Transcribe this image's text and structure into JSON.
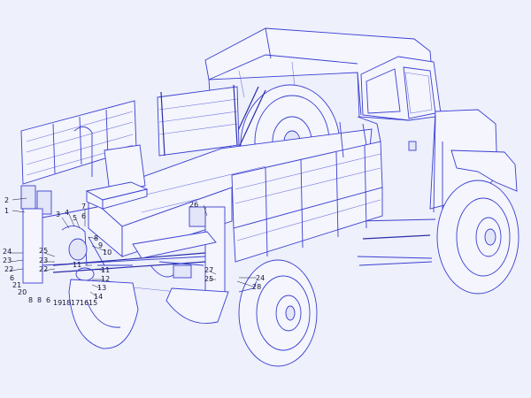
{
  "figure": {
    "background": "#eef0fb",
    "line_color": "#3a3fd0",
    "callouts": [
      {
        "id": "c2",
        "label": "2"
      },
      {
        "id": "c1",
        "label": "1"
      },
      {
        "id": "c3",
        "label": "3"
      },
      {
        "id": "c4",
        "label": "4"
      },
      {
        "id": "c5",
        "label": "5"
      },
      {
        "id": "c6a",
        "label": "6"
      },
      {
        "id": "c7",
        "label": "7"
      },
      {
        "id": "c8a",
        "label": "8"
      },
      {
        "id": "c9",
        "label": "9"
      },
      {
        "id": "c10",
        "label": "10"
      },
      {
        "id": "c11a",
        "label": "11"
      },
      {
        "id": "c11b",
        "label": "11"
      },
      {
        "id": "c12",
        "label": "12"
      },
      {
        "id": "c13",
        "label": "13"
      },
      {
        "id": "c14",
        "label": "14"
      },
      {
        "id": "c15",
        "label": "15"
      },
      {
        "id": "c16",
        "label": "16"
      },
      {
        "id": "c17",
        "label": "17"
      },
      {
        "id": "c18",
        "label": "18"
      },
      {
        "id": "c19",
        "label": "19"
      },
      {
        "id": "c6b",
        "label": "6"
      },
      {
        "id": "c8b",
        "label": "8"
      },
      {
        "id": "c8c",
        "label": "8"
      },
      {
        "id": "c20",
        "label": "20"
      },
      {
        "id": "c21",
        "label": "21"
      },
      {
        "id": "c6c",
        "label": "6"
      },
      {
        "id": "c22a",
        "label": "22"
      },
      {
        "id": "c23a",
        "label": "23"
      },
      {
        "id": "c24a",
        "label": "24"
      },
      {
        "id": "c25a",
        "label": "25"
      },
      {
        "id": "c23b",
        "label": "23"
      },
      {
        "id": "c22b",
        "label": "22"
      },
      {
        "id": "c26",
        "label": "26"
      },
      {
        "id": "c27",
        "label": "27"
      },
      {
        "id": "c25b",
        "label": "25"
      },
      {
        "id": "c24b",
        "label": "24"
      },
      {
        "id": "c28",
        "label": "28"
      }
    ]
  }
}
